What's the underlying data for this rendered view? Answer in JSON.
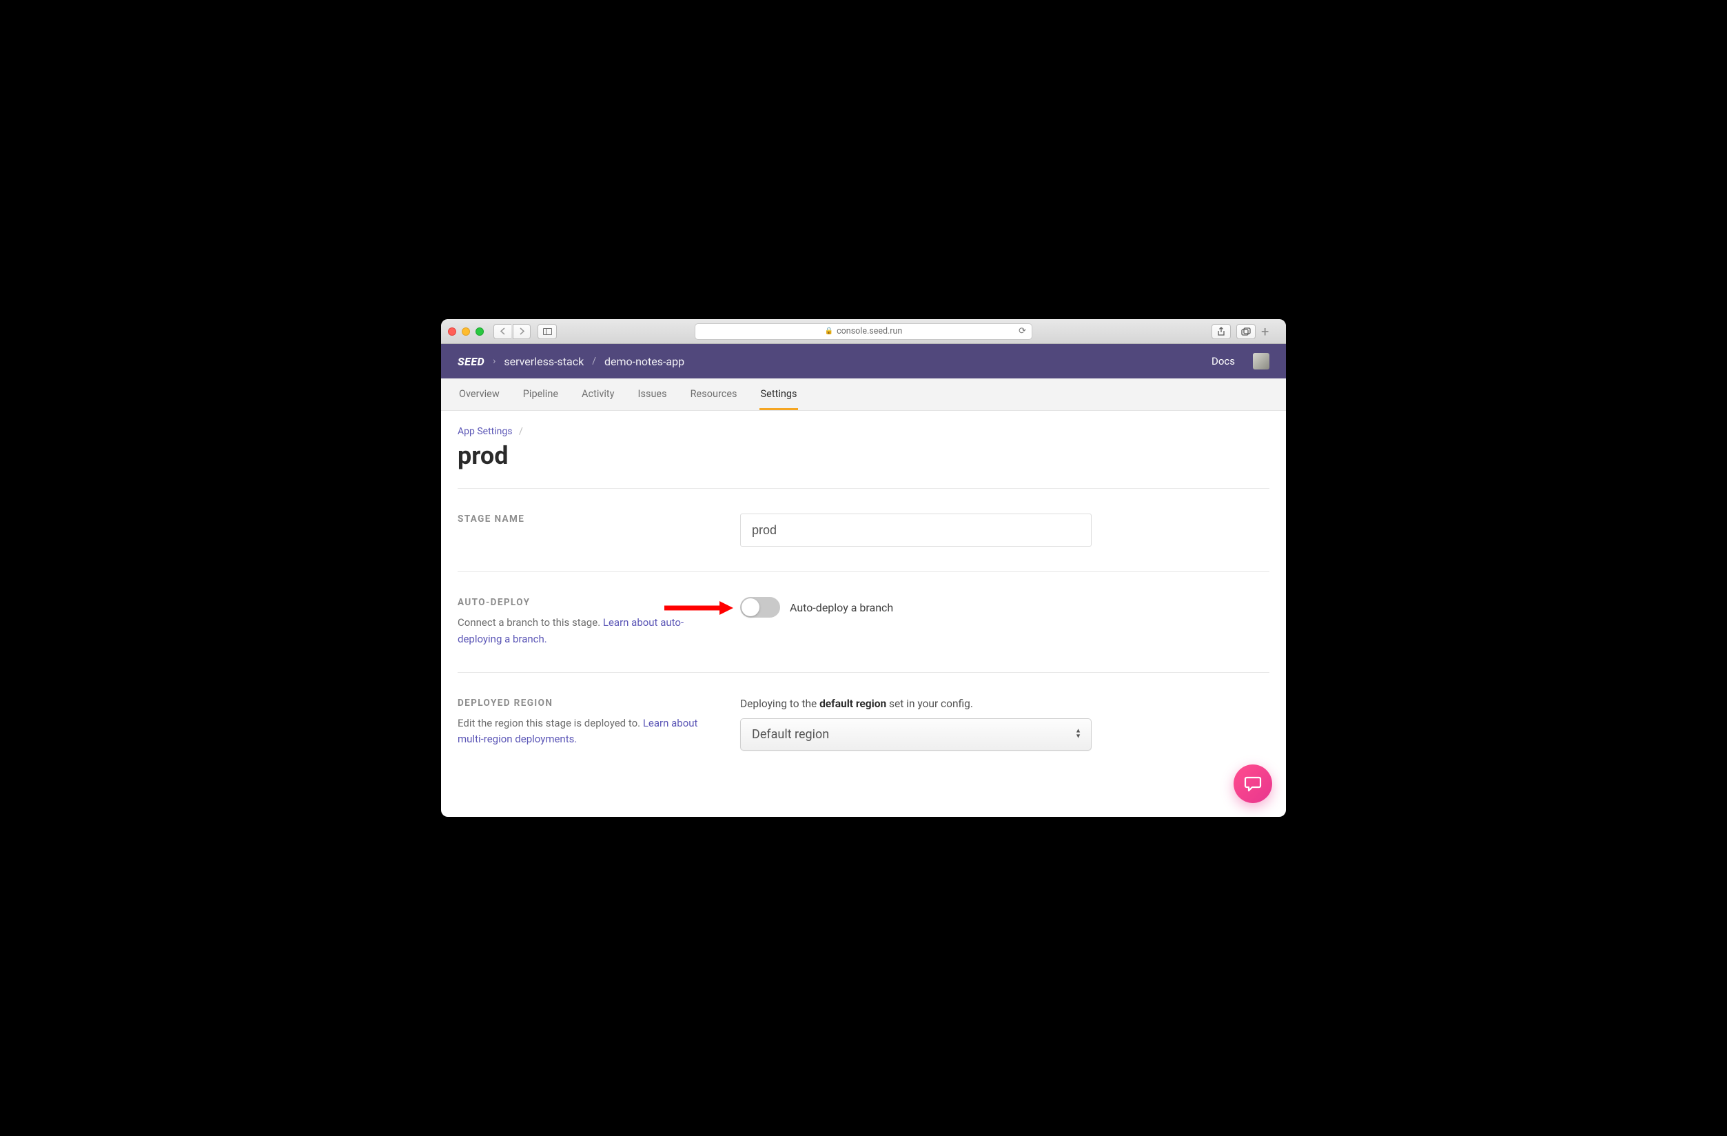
{
  "browser": {
    "url": "console.seed.run"
  },
  "header": {
    "logo": "SEED",
    "crumbs": [
      "serverless-stack",
      "demo-notes-app"
    ],
    "docs": "Docs"
  },
  "tabs": [
    {
      "label": "Overview",
      "active": false
    },
    {
      "label": "Pipeline",
      "active": false
    },
    {
      "label": "Activity",
      "active": false
    },
    {
      "label": "Issues",
      "active": false
    },
    {
      "label": "Resources",
      "active": false
    },
    {
      "label": "Settings",
      "active": true
    }
  ],
  "breadcrumb": {
    "parent": "App Settings",
    "title": "prod"
  },
  "stage_name": {
    "label": "STAGE NAME",
    "value": "prod"
  },
  "auto_deploy": {
    "label": "AUTO-DEPLOY",
    "desc_prefix": "Connect a branch to this stage. ",
    "desc_link": "Learn about auto-deploying a branch.",
    "toggle_label": "Auto-deploy a branch",
    "toggle_on": false
  },
  "region": {
    "label": "DEPLOYED REGION",
    "desc_prefix": "Edit the region this stage is deployed to. ",
    "desc_link": "Learn about multi-region deployments.",
    "hint_prefix": "Deploying to the ",
    "hint_strong": "default region",
    "hint_suffix": " set in your config.",
    "select_value": "Default region"
  }
}
